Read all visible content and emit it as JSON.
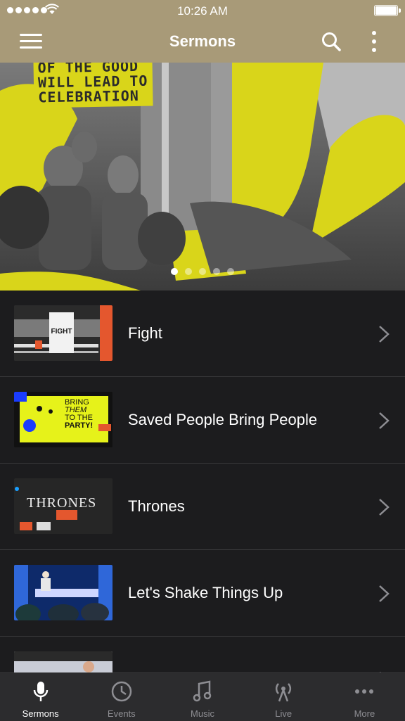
{
  "status_bar": {
    "time": "10:26 AM"
  },
  "nav": {
    "title": "Sermons"
  },
  "hero": {
    "text_lines": [
      "OF THE GOOD",
      "WILL LEAD TO",
      "CELEBRATION"
    ],
    "dot_count": 5,
    "active_dot": 0
  },
  "sermons": [
    {
      "title": "Fight",
      "thumb_text": "FIGHT"
    },
    {
      "title": "Saved People Bring People",
      "thumb_text": [
        "BRING",
        "THEM",
        "TO THE",
        "PARTY!"
      ]
    },
    {
      "title": "Thrones",
      "thumb_text": "THRONES"
    },
    {
      "title": "Let's Shake Things Up"
    },
    {
      "title": ""
    }
  ],
  "tabs": [
    {
      "label": "Sermons",
      "icon": "microphone-icon",
      "active": true
    },
    {
      "label": "Events",
      "icon": "clock-icon",
      "active": false
    },
    {
      "label": "Music",
      "icon": "music-note-icon",
      "active": false
    },
    {
      "label": "Live",
      "icon": "broadcast-icon",
      "active": false
    },
    {
      "label": "More",
      "icon": "ellipsis-icon",
      "active": false
    }
  ],
  "colors": {
    "header_bg": "#a89a78",
    "list_bg": "#1c1c1e",
    "tabbar_bg": "#2c2c2e",
    "accent_yellow": "#d9d51a"
  }
}
